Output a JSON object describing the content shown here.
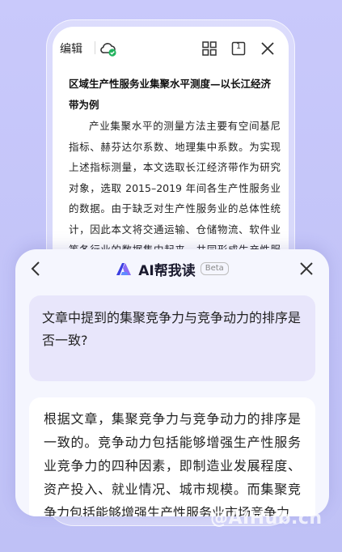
{
  "toolbar": {
    "edit_label": "编辑",
    "icons": [
      "cloud-synced-icon",
      "grid-icon",
      "page-count-icon",
      "close-icon"
    ],
    "page_count": "1"
  },
  "document": {
    "title": "区域生产性服务业集聚水平测度—以长江经济带为例",
    "body": "产业集聚水平的测量方法主要有空间基尼指标、赫芬达尔系数、地理集中系数。为实现上述指标测量，本文选取长江经济带作为研究对象，选取 2015–2019 年间各生产性服务业的数据。由于缺乏对生产性服务业的总体性统计，因此本文将交通运输、仓储物流、软件业等各行业的数据集中起来，共同形成生产性服务业的数据。"
  },
  "ai_panel": {
    "title": "AI帮我读",
    "badge": "Beta",
    "question": "文章中提到的集聚竞争力与竞争动力的排序是否一致?",
    "answer": "根据文章，集聚竞争力与竞争动力的排序是一致的。竞争动力包括能够增强生产性服务业竞争力的四种因素，即制造业发展程度、资产投入、就业情况、城市规模。而集聚竞争力包括能够增强生产性服务业市场竞争力"
  },
  "colors": {
    "accent": "#5b5bf0",
    "sync_green": "#22b35e",
    "question_bg": "#e8e6fb",
    "background": "#c6c6fa"
  },
  "watermark": "@AIHub.cn"
}
